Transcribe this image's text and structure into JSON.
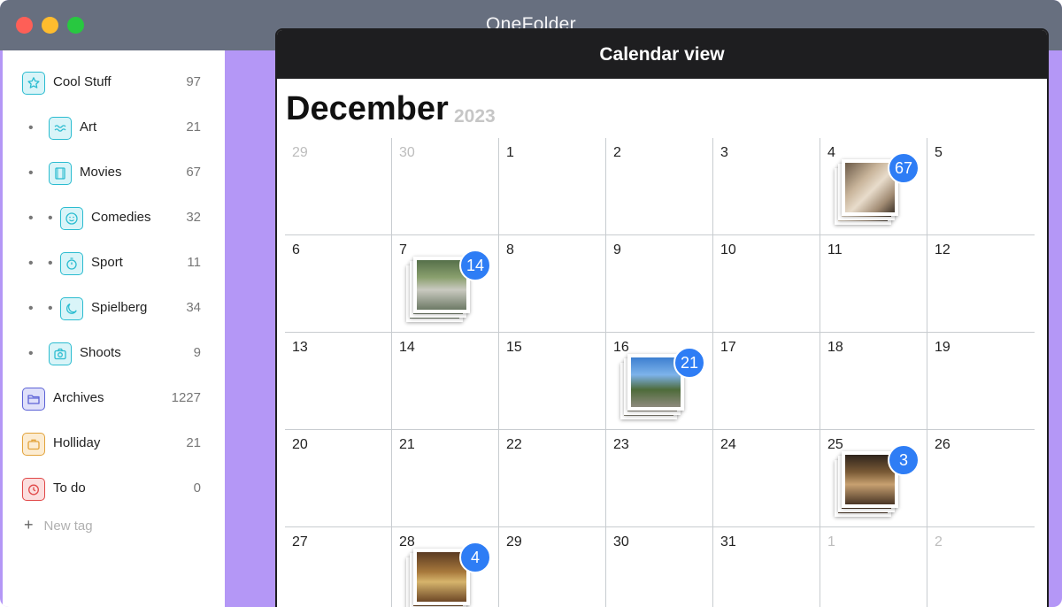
{
  "window": {
    "title": "OneFolder",
    "controls": [
      "close-button",
      "minimize-button",
      "zoom-button"
    ]
  },
  "sidebar": {
    "tags": [
      {
        "label": "Cool Stuff",
        "count": "97",
        "icon": "star-icon",
        "color": "#2bbcd0",
        "fill": "#d9f4f8",
        "depth": 0
      },
      {
        "label": "Art",
        "count": "21",
        "icon": "waves-icon",
        "color": "#2bbcd0",
        "fill": "#d9f4f8",
        "depth": 1
      },
      {
        "label": "Movies",
        "count": "67",
        "icon": "film-icon",
        "color": "#2bbcd0",
        "fill": "#d9f4f8",
        "depth": 1
      },
      {
        "label": "Comedies",
        "count": "32",
        "icon": "smile-icon",
        "color": "#2bbcd0",
        "fill": "#d9f4f8",
        "depth": 2
      },
      {
        "label": "Sport",
        "count": "11",
        "icon": "stopwatch-icon",
        "color": "#2bbcd0",
        "fill": "#d9f4f8",
        "depth": 2
      },
      {
        "label": "Spielberg",
        "count": "34",
        "icon": "moon-icon",
        "color": "#2bbcd0",
        "fill": "#d9f4f8",
        "depth": 2
      },
      {
        "label": "Shoots",
        "count": "9",
        "icon": "camera-icon",
        "color": "#2bbcd0",
        "fill": "#d9f4f8",
        "depth": 1
      },
      {
        "label": "Archives",
        "count": "1227",
        "icon": "folder-icon",
        "color": "#5c62d6",
        "fill": "#dfe0fa",
        "depth": 0
      },
      {
        "label": "Holliday",
        "count": "21",
        "icon": "suitcase-icon",
        "color": "#e2a33b",
        "fill": "#fcecd2",
        "depth": 0
      },
      {
        "label": "To do",
        "count": "0",
        "icon": "clock-icon",
        "color": "#e04848",
        "fill": "#fbdede",
        "depth": 0
      }
    ],
    "new_tag": {
      "label": "New tag",
      "icon": "plus-icon"
    }
  },
  "calendar": {
    "header": "Calendar view",
    "month": "December",
    "year": "2023",
    "accent": "#2e7df5",
    "weeks": [
      [
        "29",
        "30",
        "1",
        "2",
        "3",
        "4",
        "5"
      ],
      [
        "6",
        "7",
        "8",
        "9",
        "10",
        "11",
        "12"
      ],
      [
        "13",
        "14",
        "15",
        "16",
        "17",
        "18",
        "19"
      ],
      [
        "20",
        "21",
        "22",
        "23",
        "24",
        "25",
        "26"
      ],
      [
        "27",
        "28",
        "29",
        "30",
        "31",
        "1",
        "2"
      ]
    ],
    "muted_days": [
      [
        0,
        0
      ],
      [
        0,
        1
      ],
      [
        4,
        5
      ],
      [
        4,
        6
      ]
    ],
    "photo_stacks": [
      {
        "week": 0,
        "day": 5,
        "count": "67",
        "thumb": "pug"
      },
      {
        "week": 1,
        "day": 1,
        "count": "14",
        "thumb": "garden"
      },
      {
        "week": 2,
        "day": 3,
        "count": "21",
        "thumb": "palms"
      },
      {
        "week": 3,
        "day": 5,
        "count": "3",
        "thumb": "street"
      },
      {
        "week": 4,
        "day": 1,
        "count": "4",
        "thumb": "interior"
      }
    ]
  }
}
